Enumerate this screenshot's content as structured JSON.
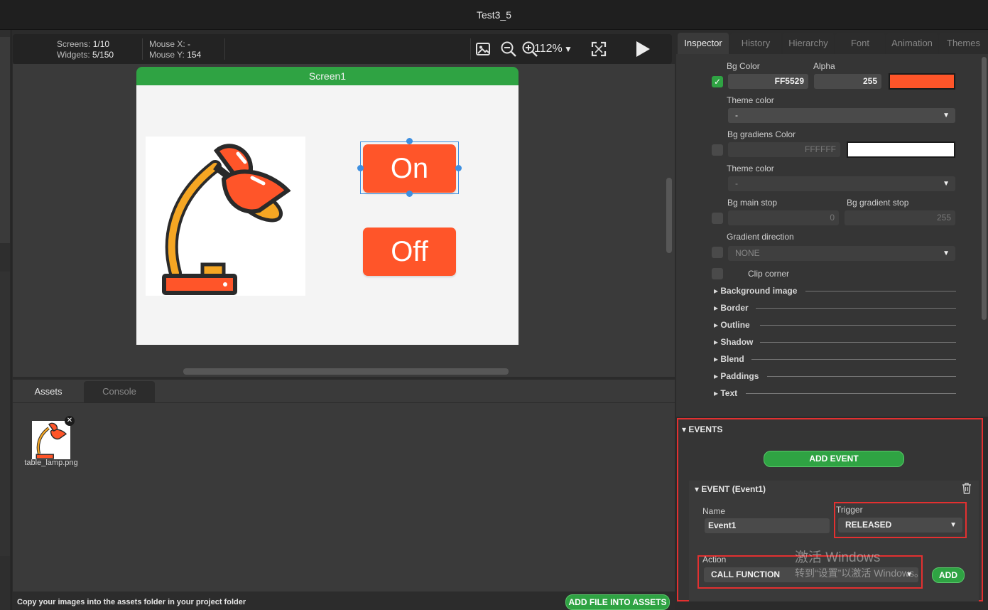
{
  "window": {
    "title": "Test3_5"
  },
  "toolbar": {
    "screens_label": "Screens:",
    "screens_value": "1/10",
    "widgets_label": "Widgets:",
    "widgets_value": "5/150",
    "mouse_x_label": "Mouse X:",
    "mouse_x_value": "-",
    "mouse_y_label": "Mouse Y:",
    "mouse_y_value": "154",
    "zoom": "112%",
    "icons": [
      "image-icon",
      "zoom-out-icon",
      "zoom-in-icon",
      "fullscreen-icon",
      "play-icon"
    ]
  },
  "canvas": {
    "screen_name": "Screen1",
    "button_on_label": "On",
    "button_off_label": "Off",
    "button_color": "#FF5529"
  },
  "bottom": {
    "tabs": [
      "Assets",
      "Console"
    ],
    "asset_name": "table_lamp.png",
    "footer_text": "Copy your images into the assets folder in your project folder",
    "add_file_button": "ADD FILE INTO ASSETS"
  },
  "inspector": {
    "tabs": [
      "Inspector",
      "History",
      "Hierarchy",
      "Font",
      "Animation",
      "Themes"
    ],
    "bg_color_label": "Bg Color",
    "bg_color_value": "FF5529",
    "alpha_label": "Alpha",
    "alpha_value": "255",
    "theme_color_label": "Theme color",
    "theme_color_value": "-",
    "bg_gradient_label": "Bg gradiens Color",
    "bg_gradient_value": "FFFFFF",
    "theme_color2_label": "Theme color",
    "theme_color2_value": "-",
    "bg_main_stop_label": "Bg main stop",
    "bg_main_stop_value": "0",
    "bg_gradient_stop_label": "Bg gradient stop",
    "bg_gradient_stop_value": "255",
    "gradient_direction_label": "Gradient direction",
    "gradient_direction_value": "NONE",
    "clip_corner_label": "Clip corner",
    "sections": [
      "Background image",
      "Border",
      "Outline",
      "Shadow",
      "Blend",
      "Paddings",
      "Text"
    ]
  },
  "events": {
    "title": "EVENTS",
    "add_event_button": "ADD EVENT",
    "event_header": "EVENT (Event1)",
    "name_label": "Name",
    "name_value": "Event1",
    "trigger_label": "Trigger",
    "trigger_value": "RELEASED",
    "action_label": "Action",
    "action_value": "CALL FUNCTION",
    "add_button": "ADD"
  },
  "watermark": {
    "line1": "激活 Windows",
    "line2": "转到“设置”以激活 Windows。"
  },
  "colors": {
    "accent_green": "#2FA343",
    "highlight_red": "#E33030",
    "selection_blue": "#3D8FE0"
  }
}
